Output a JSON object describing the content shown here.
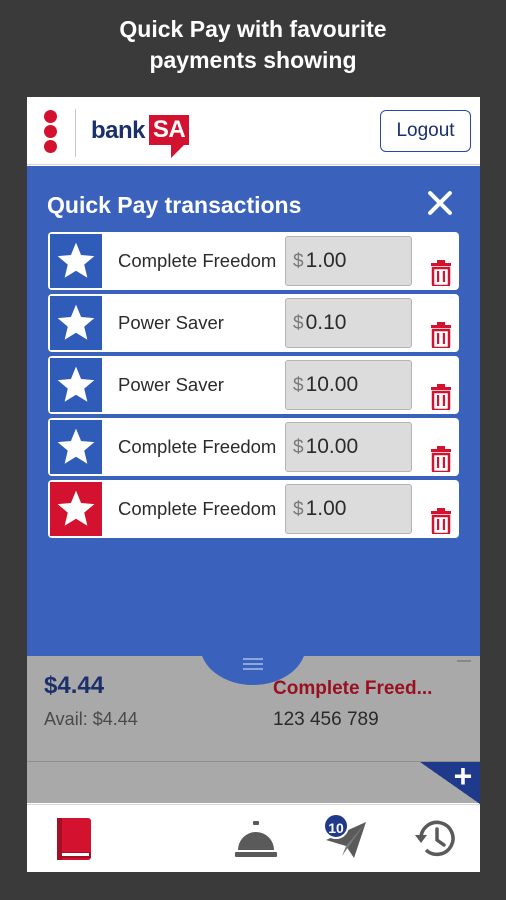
{
  "caption": {
    "line1": "Quick Pay with favourite",
    "line2": "payments showing"
  },
  "header": {
    "logo_bank": "bank",
    "logo_sa": "SA",
    "logout_label": "Logout"
  },
  "modal": {
    "title": "Quick Pay transactions",
    "rows": [
      {
        "name": "Complete Freedom",
        "currency": "$",
        "amount": "1.00",
        "star_color": "#2f5cb8"
      },
      {
        "name": "Power Saver",
        "currency": "$",
        "amount": "0.10",
        "star_color": "#2f5cb8"
      },
      {
        "name": "Power Saver",
        "currency": "$",
        "amount": "10.00",
        "star_color": "#2f5cb8"
      },
      {
        "name": "Complete Freedom",
        "currency": "$",
        "amount": "10.00",
        "star_color": "#2f5cb8"
      },
      {
        "name": "Complete Freedom",
        "currency": "$",
        "amount": "1.00",
        "star_color": "#d2122e"
      }
    ]
  },
  "account": {
    "balance": "$4.44",
    "available": "Avail: $4.44",
    "name": "Complete Freed...",
    "number": "123 456 789"
  },
  "nav": {
    "badge_count": "10",
    "icons": [
      "book-icon",
      "bell-icon",
      "paper-plane-icon",
      "history-icon"
    ]
  },
  "colors": {
    "brand_red": "#d2122e",
    "brand_blue": "#1b2f6b",
    "modal_blue": "#3a62bc"
  }
}
